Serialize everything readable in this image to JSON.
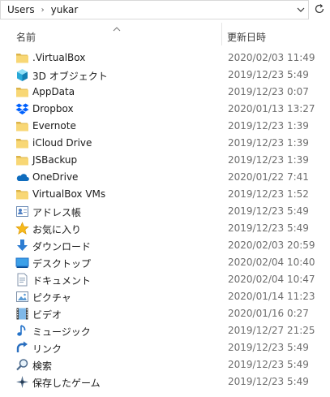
{
  "address": {
    "crumbs": [
      "Users",
      "yukar"
    ],
    "separator": "›"
  },
  "columns": {
    "name": "名前",
    "date": "更新日時"
  },
  "items": [
    {
      "name": ".VirtualBox",
      "date": "2020/02/03 11:49",
      "icon": "folder-icon"
    },
    {
      "name": "3D オブジェクト",
      "date": "2019/12/23 5:49",
      "icon": "3d-objects-icon"
    },
    {
      "name": "AppData",
      "date": "2019/12/23 0:07",
      "icon": "folder-icon"
    },
    {
      "name": "Dropbox",
      "date": "2020/01/13 13:27",
      "icon": "dropbox-icon"
    },
    {
      "name": "Evernote",
      "date": "2019/12/23 1:39",
      "icon": "folder-icon"
    },
    {
      "name": "iCloud Drive",
      "date": "2019/12/23 1:39",
      "icon": "folder-icon"
    },
    {
      "name": "JSBackup",
      "date": "2019/12/23 1:39",
      "icon": "folder-icon"
    },
    {
      "name": "OneDrive",
      "date": "2020/01/22 7:41",
      "icon": "onedrive-icon"
    },
    {
      "name": "VirtualBox VMs",
      "date": "2019/12/23 1:52",
      "icon": "folder-icon"
    },
    {
      "name": "アドレス帳",
      "date": "2019/12/23 5:49",
      "icon": "contacts-icon"
    },
    {
      "name": "お気に入り",
      "date": "2019/12/23 5:49",
      "icon": "favorites-star-icon"
    },
    {
      "name": "ダウンロード",
      "date": "2020/02/03 20:59",
      "icon": "downloads-icon"
    },
    {
      "name": "デスクトップ",
      "date": "2020/02/04 10:40",
      "icon": "desktop-icon"
    },
    {
      "name": "ドキュメント",
      "date": "2020/02/04 10:47",
      "icon": "documents-icon"
    },
    {
      "name": "ピクチャ",
      "date": "2020/01/14 11:23",
      "icon": "pictures-icon"
    },
    {
      "name": "ビデオ",
      "date": "2020/01/16 0:27",
      "icon": "videos-icon"
    },
    {
      "name": "ミュージック",
      "date": "2019/12/27 21:25",
      "icon": "music-icon"
    },
    {
      "name": "リンク",
      "date": "2019/12/23 5:49",
      "icon": "links-icon"
    },
    {
      "name": "検索",
      "date": "2019/12/23 5:49",
      "icon": "searches-icon"
    },
    {
      "name": "保存したゲーム",
      "date": "2019/12/23 5:49",
      "icon": "saved-games-icon"
    }
  ]
}
